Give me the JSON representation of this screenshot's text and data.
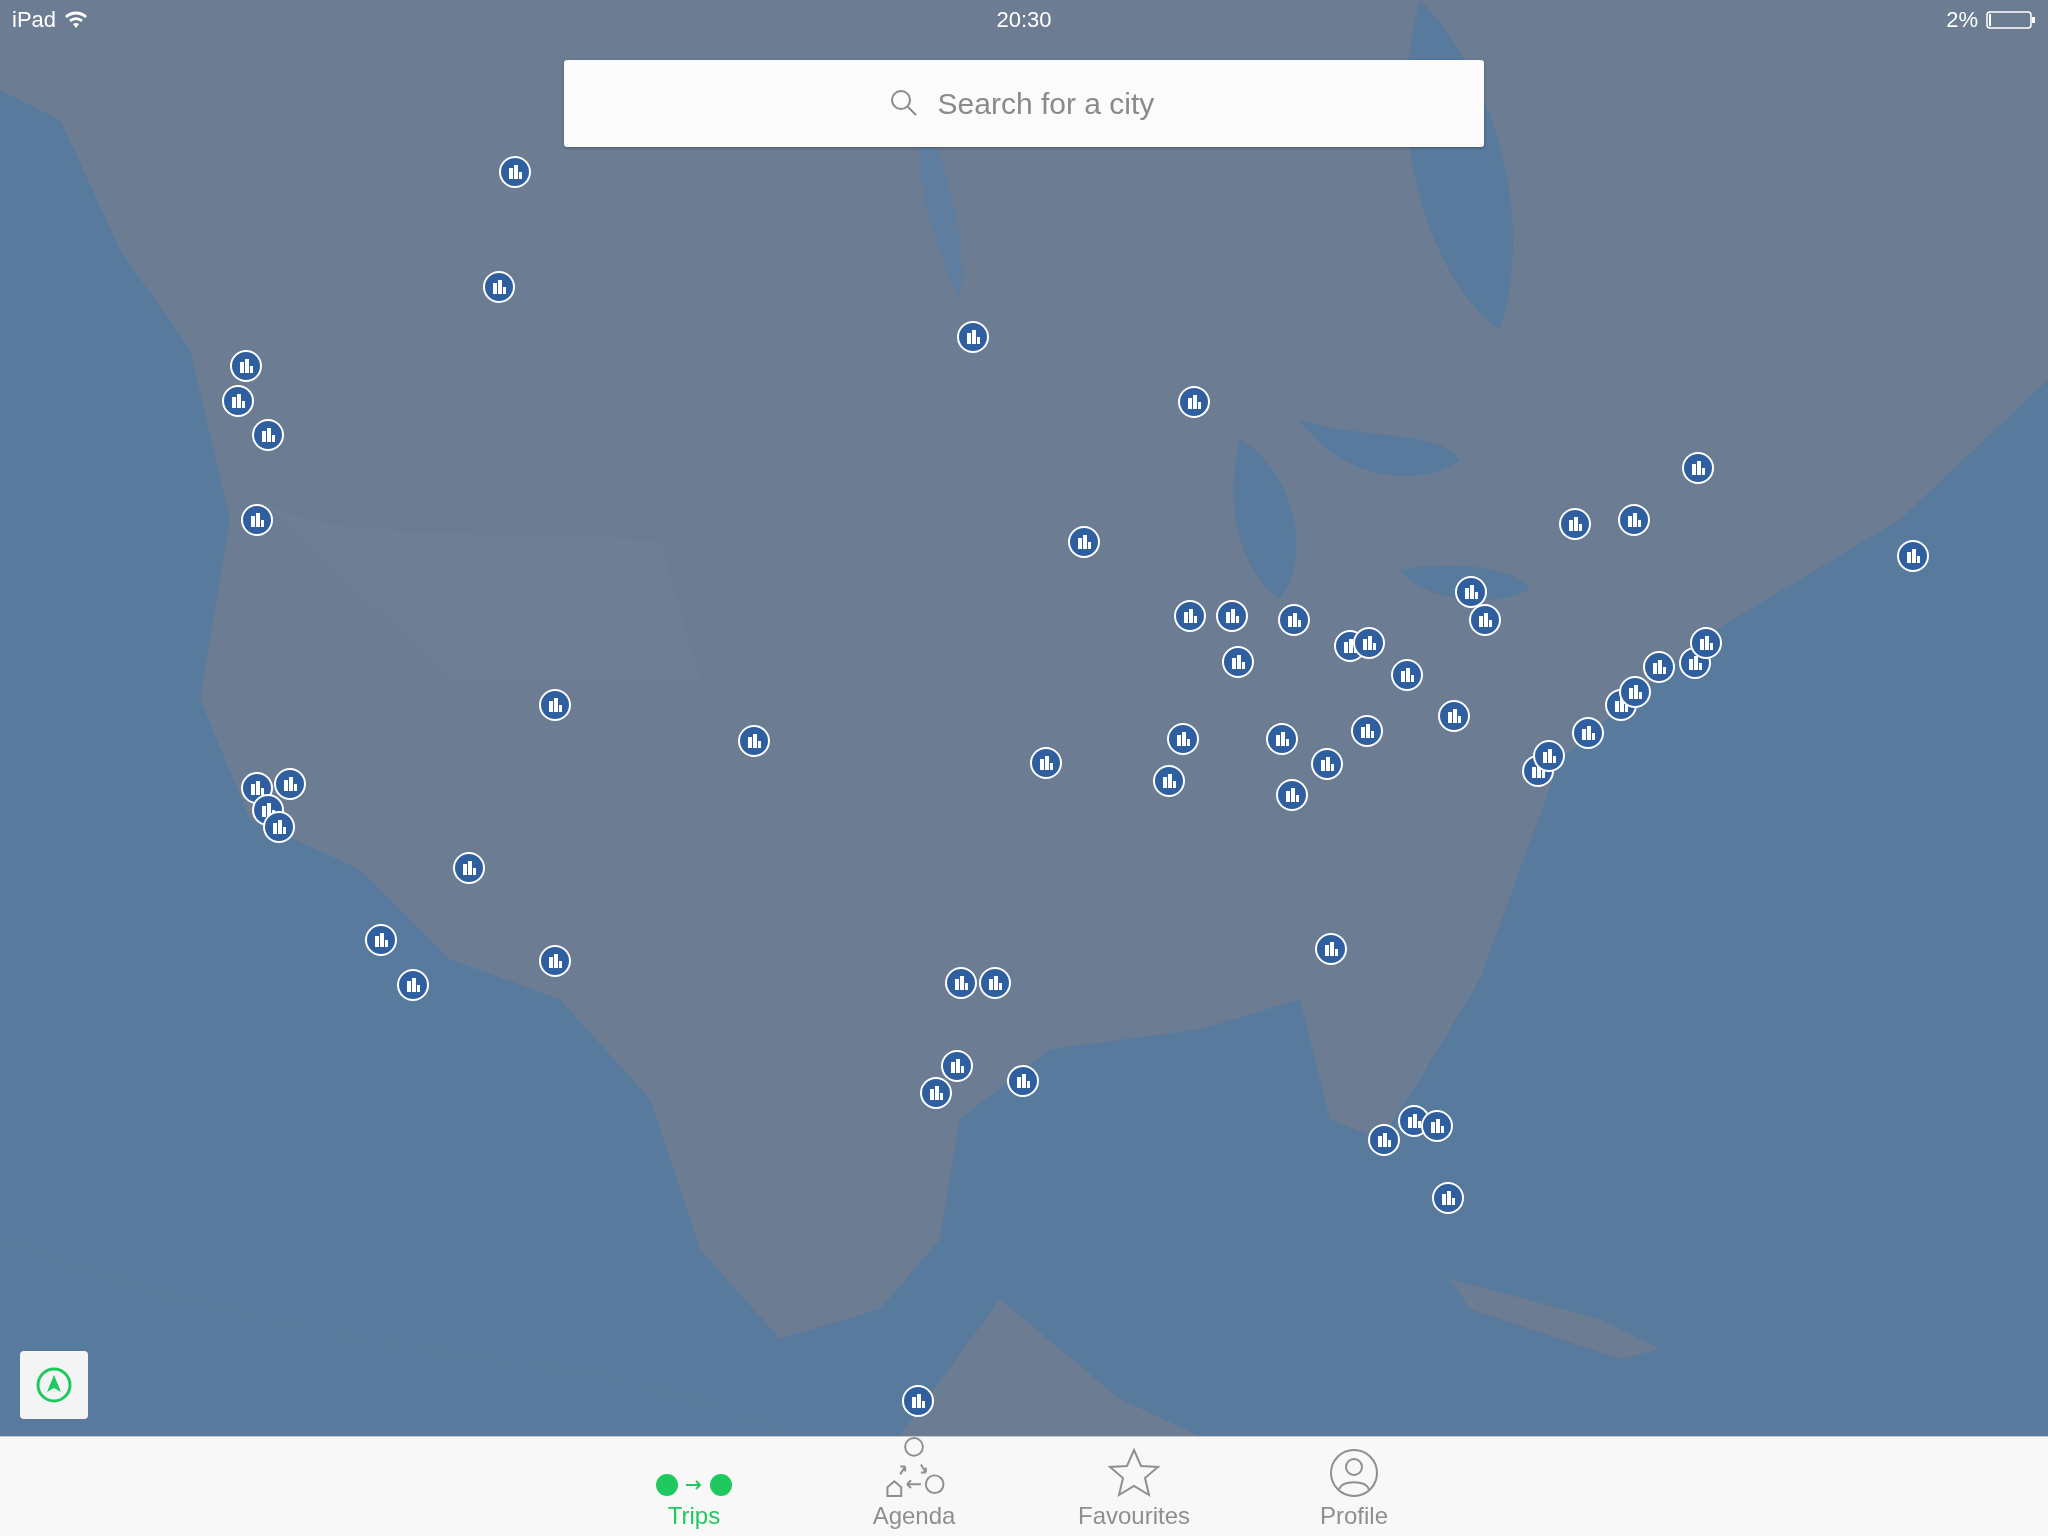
{
  "status_bar": {
    "device": "iPad",
    "time": "20:30",
    "battery": "2%"
  },
  "search": {
    "placeholder": "Search for a city"
  },
  "tabs": [
    {
      "label": "Trips",
      "kind": "trips",
      "selected": true
    },
    {
      "label": "Agenda",
      "kind": "agenda",
      "selected": false
    },
    {
      "label": "Favourites",
      "kind": "favourites",
      "selected": false
    },
    {
      "label": "Profile",
      "kind": "profile",
      "selected": false
    }
  ]
}
